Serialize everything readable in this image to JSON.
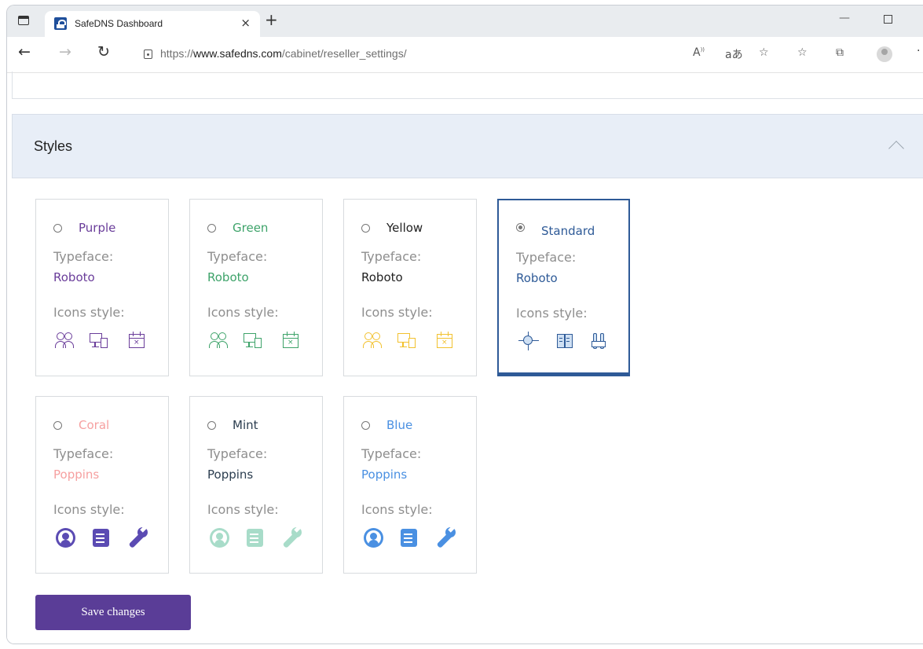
{
  "browser": {
    "tab_title": "SafeDNS Dashboard",
    "tab_close": "×",
    "new_tab": "+",
    "url_prefix": "https://",
    "url_host": "www.safedns.com",
    "url_path": "/cabinet/reseller_settings/",
    "toolbar_icons": [
      "read-aloud-icon",
      "translate-icon",
      "favorite-add-icon",
      "favorites-icon",
      "collections-icon",
      "profile-icon",
      "more-icon"
    ]
  },
  "panel": {
    "title": "Styles"
  },
  "styles": [
    {
      "name": "Purple",
      "selected": false,
      "typeface_label": "Typeface:",
      "typeface": "Roboto",
      "icons_label": "Icons style:",
      "color": "#6a3d9a",
      "icon_set": "line"
    },
    {
      "name": "Green",
      "selected": false,
      "typeface_label": "Typeface:",
      "typeface": "Roboto",
      "icons_label": "Icons style:",
      "color": "#3ea36a",
      "icon_set": "line"
    },
    {
      "name": "Yellow",
      "selected": false,
      "typeface_label": "Typeface:",
      "typeface": "Roboto",
      "icons_label": "Icons style:",
      "color": "#222222",
      "icon_color": "#f2c12e",
      "icon_set": "line"
    },
    {
      "name": "Standard",
      "selected": true,
      "typeface_label": "Typeface:",
      "typeface": "Roboto",
      "icons_label": "Icons style:",
      "color": "#2e5a97",
      "icon_set": "standard"
    },
    {
      "name": "Coral",
      "selected": false,
      "typeface_label": "Typeface:",
      "typeface": "Poppins",
      "icons_label": "Icons style:",
      "color": "#f6a0a0",
      "icon_color": "#5b4bb3",
      "icon_set": "solid"
    },
    {
      "name": "Mint",
      "selected": false,
      "typeface_label": "Typeface:",
      "typeface": "Poppins",
      "icons_label": "Icons style:",
      "color": "#2c3e50",
      "icon_color": "#a8dcc9",
      "icon_set": "solid"
    },
    {
      "name": "Blue",
      "selected": false,
      "typeface_label": "Typeface:",
      "typeface": "Poppins",
      "icons_label": "Icons style:",
      "color": "#4a90e2",
      "icon_color": "#4a90e2",
      "icon_set": "solid"
    }
  ],
  "save_button": "Save changes",
  "colors": {
    "panel_header_bg": "#e8eef7",
    "selected_border": "#2e5a97",
    "save_button_bg": "#5a3d97"
  }
}
